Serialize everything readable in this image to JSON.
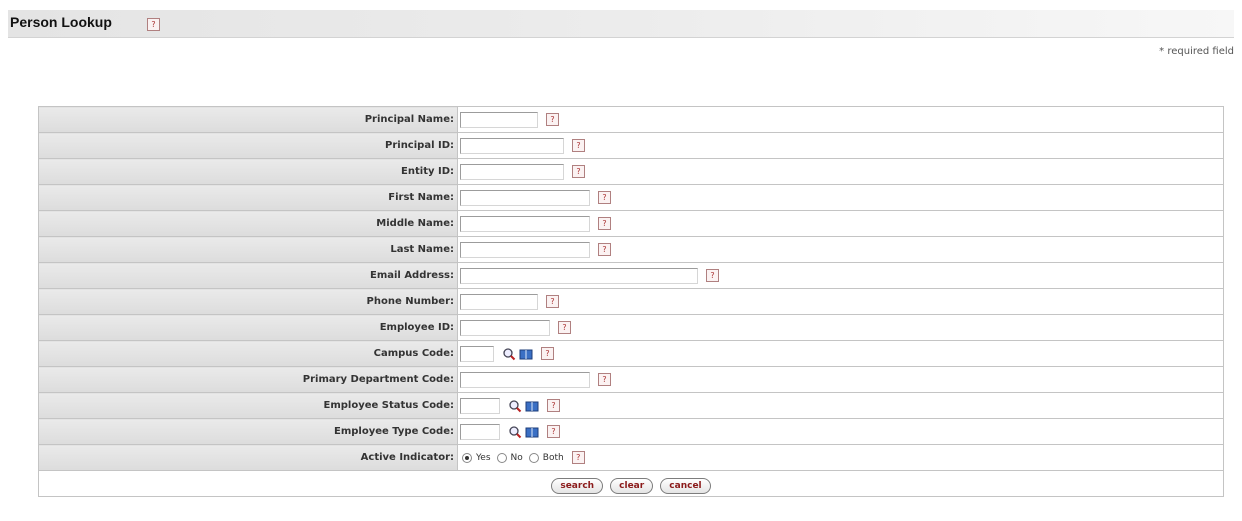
{
  "header": {
    "title": "Person Lookup",
    "help_icon": "help-question-icon"
  },
  "required_note": "* required field",
  "fields": [
    {
      "label": "Principal Name:",
      "value": ""
    },
    {
      "label": "Principal ID:",
      "value": ""
    },
    {
      "label": "Entity ID:",
      "value": ""
    },
    {
      "label": "First Name:",
      "value": ""
    },
    {
      "label": "Middle Name:",
      "value": ""
    },
    {
      "label": "Last Name:",
      "value": ""
    },
    {
      "label": "Email Address:",
      "value": ""
    },
    {
      "label": "Phone Number:",
      "value": ""
    },
    {
      "label": "Employee ID:",
      "value": ""
    },
    {
      "label": "Campus Code:",
      "value": "",
      "icons": [
        "search-lookup-icon",
        "direct-inquiry-book-icon"
      ]
    },
    {
      "label": "Primary Department Code:",
      "value": ""
    },
    {
      "label": "Employee Status Code:",
      "value": "",
      "icons": [
        "search-lookup-icon",
        "direct-inquiry-book-icon"
      ]
    },
    {
      "label": "Employee Type Code:",
      "value": "",
      "icons": [
        "search-lookup-icon",
        "direct-inquiry-book-icon"
      ]
    }
  ],
  "active_indicator": {
    "label": "Active Indicator:",
    "options": [
      "Yes",
      "No",
      "Both"
    ],
    "selected": "Yes"
  },
  "buttons": {
    "search": "search",
    "clear": "clear",
    "cancel": "cancel"
  },
  "colors": {
    "button_text": "#8b1a1a",
    "label_bg": "#e2e2e2",
    "help_icon": "#a33333"
  }
}
